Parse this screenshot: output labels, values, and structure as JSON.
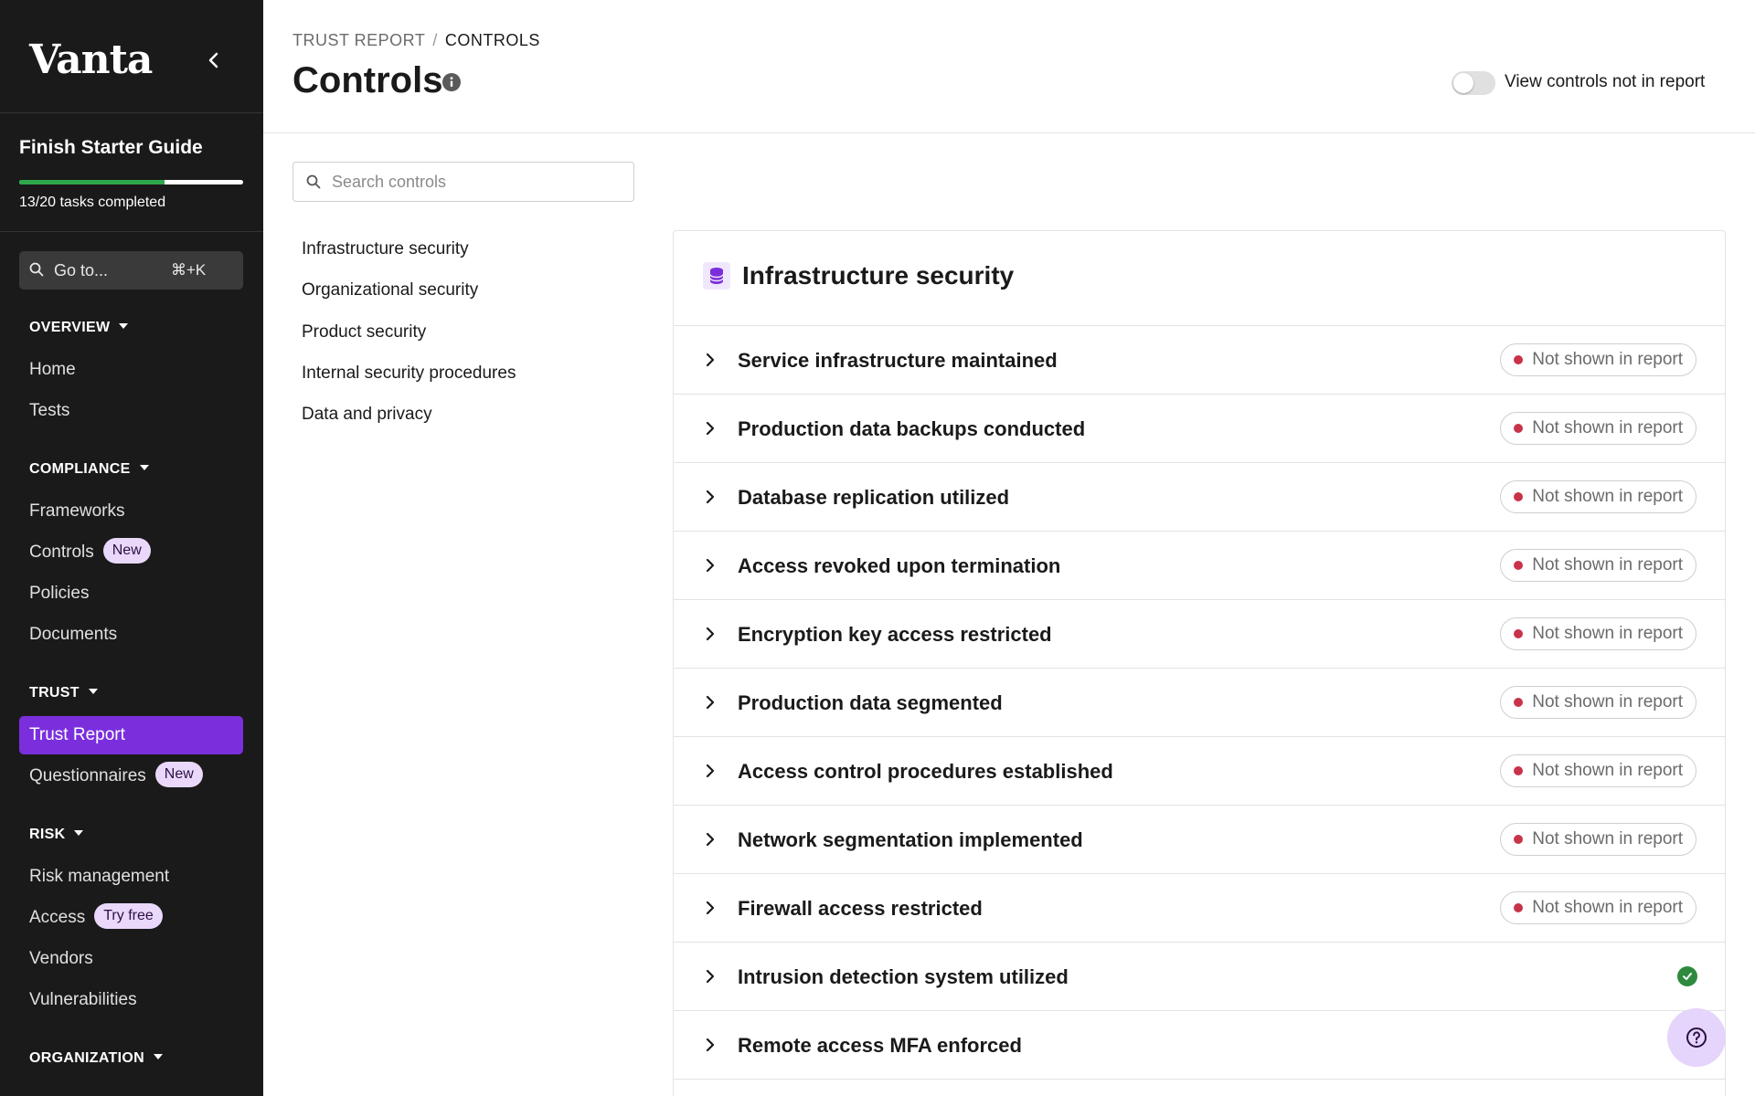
{
  "app": {
    "logo": "Vanta",
    "colors": {
      "sidebar_bg": "#1a1a1a",
      "accent": "#7b2fdc",
      "badge_bg": "#ead8fb",
      "progress": "#2ea84a",
      "status_red": "#c8334a",
      "status_green": "#2e8a3f"
    }
  },
  "starter_guide": {
    "title": "Finish Starter Guide",
    "tasks_text": "13/20 tasks completed",
    "completed": 13,
    "total": 20
  },
  "goto": {
    "label": "Go to...",
    "shortcut": "⌘+K"
  },
  "sidebar": {
    "sections": [
      {
        "title": "OVERVIEW",
        "items": [
          {
            "label": "Home"
          },
          {
            "label": "Tests"
          }
        ]
      },
      {
        "title": "COMPLIANCE",
        "items": [
          {
            "label": "Frameworks"
          },
          {
            "label": "Controls",
            "badge": "New"
          },
          {
            "label": "Policies"
          },
          {
            "label": "Documents"
          }
        ]
      },
      {
        "title": "TRUST",
        "items": [
          {
            "label": "Trust Report",
            "active": true
          },
          {
            "label": "Questionnaires",
            "badge": "New"
          }
        ]
      },
      {
        "title": "RISK",
        "items": [
          {
            "label": "Risk management"
          },
          {
            "label": "Access",
            "badge": "Try free"
          },
          {
            "label": "Vendors"
          },
          {
            "label": "Vulnerabilities"
          }
        ]
      },
      {
        "title": "ORGANIZATION",
        "items": []
      }
    ]
  },
  "header": {
    "breadcrumb": [
      "TRUST REPORT",
      "CONTROLS"
    ],
    "breadcrumb_sep": "/",
    "title": "Controls",
    "toggle_label": "View controls not in report",
    "toggle_on": false
  },
  "search": {
    "placeholder": "Search controls",
    "value": ""
  },
  "categories": [
    "Infrastructure security",
    "Organizational security",
    "Product security",
    "Internal security procedures",
    "Data and privacy"
  ],
  "card": {
    "title": "Infrastructure security",
    "icon": "database-icon",
    "status_label": "Not shown in report",
    "rows": [
      {
        "label": "Service infrastructure maintained",
        "status": "not_shown"
      },
      {
        "label": "Production data backups conducted",
        "status": "not_shown"
      },
      {
        "label": "Database replication utilized",
        "status": "not_shown"
      },
      {
        "label": "Access revoked upon termination",
        "status": "not_shown"
      },
      {
        "label": "Encryption key access restricted",
        "status": "not_shown"
      },
      {
        "label": "Production data segmented",
        "status": "not_shown"
      },
      {
        "label": "Access control procedures established",
        "status": "not_shown"
      },
      {
        "label": "Network segmentation implemented",
        "status": "not_shown"
      },
      {
        "label": "Firewall access restricted",
        "status": "not_shown"
      },
      {
        "label": "Intrusion detection system utilized",
        "status": "shown"
      },
      {
        "label": "Remote access MFA enforced",
        "status": "none"
      }
    ]
  }
}
